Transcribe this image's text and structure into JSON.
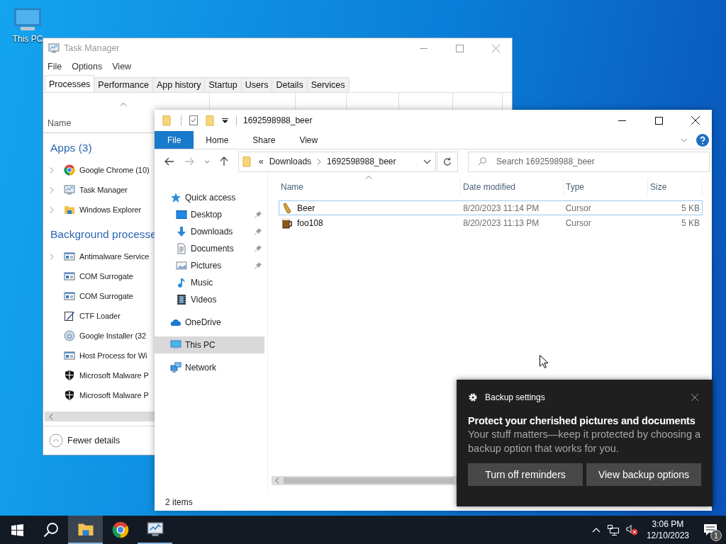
{
  "desktop": {
    "icons": [
      {
        "kind": "pc",
        "label": "This PC"
      }
    ]
  },
  "task_manager": {
    "title": "Task Manager",
    "menu": [
      "File",
      "Options",
      "View"
    ],
    "tabs": [
      {
        "label": "Processes",
        "selected": true
      },
      {
        "label": "Performance",
        "selected": false
      },
      {
        "label": "App history",
        "selected": false
      },
      {
        "label": "Startup",
        "selected": false
      },
      {
        "label": "Users",
        "selected": false
      },
      {
        "label": "Details",
        "selected": false
      },
      {
        "label": "Services",
        "selected": false
      }
    ],
    "name_column": "Name",
    "groups": [
      {
        "title": "Apps (3)",
        "rows": [
          {
            "name": "Google Chrome (10)",
            "kind": "browser",
            "expandable": true
          },
          {
            "name": "Task Manager",
            "kind": "monitor",
            "expandable": true
          },
          {
            "name": "Windows Explorer",
            "kind": "explorer",
            "expandable": true
          }
        ]
      },
      {
        "title": "Background processe",
        "rows": [
          {
            "name": "Antimalware Service",
            "kind": "window",
            "expandable": true
          },
          {
            "name": "COM Surrogate",
            "kind": "window",
            "expandable": false
          },
          {
            "name": "COM Surrogate",
            "kind": "window",
            "expandable": false
          },
          {
            "name": "CTF Loader",
            "kind": "pen",
            "expandable": false
          },
          {
            "name": "Google Installer (32",
            "kind": "disc",
            "expandable": false
          },
          {
            "name": "Host Process for Wi",
            "kind": "window",
            "expandable": false
          },
          {
            "name": "Microsoft Malware P",
            "kind": "shield",
            "expandable": false
          },
          {
            "name": "Microsoft Malware P",
            "kind": "shield",
            "expandable": false
          }
        ]
      }
    ],
    "footer": "Fewer details"
  },
  "explorer": {
    "title": "1692598988_beer",
    "ribbon_tabs": [
      {
        "label": "File",
        "selected": true
      },
      {
        "label": "Home",
        "selected": false
      },
      {
        "label": "Share",
        "selected": false
      },
      {
        "label": "View",
        "selected": false
      }
    ],
    "overflow": "«",
    "path": [
      "Downloads",
      "1692598988_beer"
    ],
    "search_placeholder": "Search 1692598988_beer",
    "nav": [
      {
        "label": "Quick access",
        "kind": "star",
        "selected": false,
        "children": [
          {
            "label": "Desktop",
            "kind": "desktop",
            "pinned": true,
            "selected": false
          },
          {
            "label": "Downloads",
            "kind": "download",
            "pinned": true,
            "selected": false
          },
          {
            "label": "Documents",
            "kind": "documents",
            "pinned": true,
            "selected": false
          },
          {
            "label": "Pictures",
            "kind": "pictures",
            "pinned": true,
            "selected": false
          },
          {
            "label": "Music",
            "kind": "music",
            "pinned": false,
            "selected": false
          },
          {
            "label": "Videos",
            "kind": "videos",
            "pinned": false,
            "selected": false
          }
        ]
      },
      {
        "label": "OneDrive",
        "kind": "cloud",
        "selected": false
      },
      {
        "label": "This PC",
        "kind": "pc",
        "selected": true
      },
      {
        "label": "Network",
        "kind": "network",
        "selected": false
      }
    ],
    "columns": [
      "Name",
      "Date modified",
      "Type",
      "Size"
    ],
    "files": [
      {
        "name": "Beer",
        "kind": "bottle",
        "date": "8/20/2023 11:14 PM",
        "type": "Cursor",
        "size": "5 KB",
        "focused": true
      },
      {
        "name": "foo108",
        "kind": "mug",
        "date": "8/20/2023 11:13 PM",
        "type": "Cursor",
        "size": "5 KB",
        "focused": false
      }
    ],
    "status": "2 items"
  },
  "notification": {
    "source": "Backup settings",
    "title": "Protect your cherished pictures and documents",
    "body": "Your stuff matters—keep it protected by choosing a backup option that works for you.",
    "buttons": [
      "Turn off reminders",
      "View backup options"
    ]
  },
  "taskbar": {
    "apps": [
      {
        "kind": "explorer",
        "active": true,
        "running": true
      },
      {
        "kind": "browser",
        "active": false,
        "running": false
      },
      {
        "kind": "monitor",
        "active": false,
        "running": true
      }
    ],
    "time": "3:06 PM",
    "date": "12/10/2023",
    "notification_count": "1"
  }
}
